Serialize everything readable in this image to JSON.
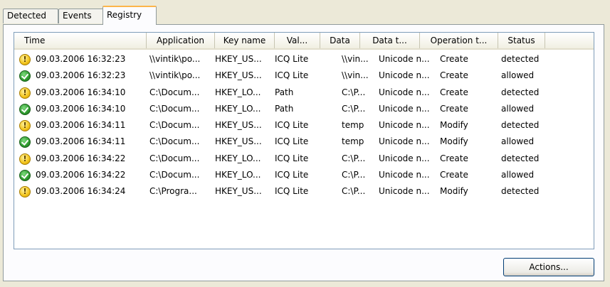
{
  "tabs": [
    {
      "label": "Detected"
    },
    {
      "label": "Events"
    },
    {
      "label": "Registry"
    }
  ],
  "active_tab": "Registry",
  "table": {
    "columns": [
      "Time",
      "Application",
      "Key name",
      "Val...",
      "Data",
      "Data t...",
      "Operation t...",
      "Status"
    ],
    "rows": [
      {
        "icon": "warning-icon",
        "time": "09.03.2006 16:32:23",
        "app": "\\\\vintik\\po...",
        "key": "HKEY_US...",
        "val": "ICQ Lite",
        "data": "\\\\vin...",
        "dtype": "Unicode n...",
        "op": "Create",
        "status": "detected"
      },
      {
        "icon": "check-icon",
        "time": "09.03.2006 16:32:23",
        "app": "\\\\vintik\\po...",
        "key": "HKEY_US...",
        "val": "ICQ Lite",
        "data": "\\\\vin...",
        "dtype": "Unicode n...",
        "op": "Create",
        "status": "allowed"
      },
      {
        "icon": "warning-icon",
        "time": "09.03.2006 16:34:10",
        "app": "C:\\Docum...",
        "key": "HKEY_LO...",
        "val": "Path",
        "data": "C:\\P...",
        "dtype": "Unicode n...",
        "op": "Create",
        "status": "detected"
      },
      {
        "icon": "check-icon",
        "time": "09.03.2006 16:34:10",
        "app": "C:\\Docum...",
        "key": "HKEY_LO...",
        "val": "Path",
        "data": "C:\\P...",
        "dtype": "Unicode n...",
        "op": "Create",
        "status": "allowed"
      },
      {
        "icon": "warning-icon",
        "time": "09.03.2006 16:34:11",
        "app": "C:\\Docum...",
        "key": "HKEY_US...",
        "val": "ICQ Lite",
        "data": "temp",
        "dtype": "Unicode n...",
        "op": "Modify",
        "status": "detected"
      },
      {
        "icon": "check-icon",
        "time": "09.03.2006 16:34:11",
        "app": "C:\\Docum...",
        "key": "HKEY_US...",
        "val": "ICQ Lite",
        "data": "temp",
        "dtype": "Unicode n...",
        "op": "Modify",
        "status": "allowed"
      },
      {
        "icon": "warning-icon",
        "time": "09.03.2006 16:34:22",
        "app": "C:\\Docum...",
        "key": "HKEY_LO...",
        "val": "ICQ Lite",
        "data": "C:\\P...",
        "dtype": "Unicode n...",
        "op": "Create",
        "status": "detected"
      },
      {
        "icon": "check-icon",
        "time": "09.03.2006 16:34:22",
        "app": "C:\\Docum...",
        "key": "HKEY_LO...",
        "val": "ICQ Lite",
        "data": "C:\\P...",
        "dtype": "Unicode n...",
        "op": "Create",
        "status": "allowed"
      },
      {
        "icon": "warning-icon",
        "time": "09.03.2006 16:34:24",
        "app": "C:\\Progra...",
        "key": "HKEY_US...",
        "val": "ICQ Lite",
        "data": "C:\\P...",
        "dtype": "Unicode n...",
        "op": "Modify",
        "status": "detected"
      }
    ]
  },
  "actions_button": "Actions..."
}
